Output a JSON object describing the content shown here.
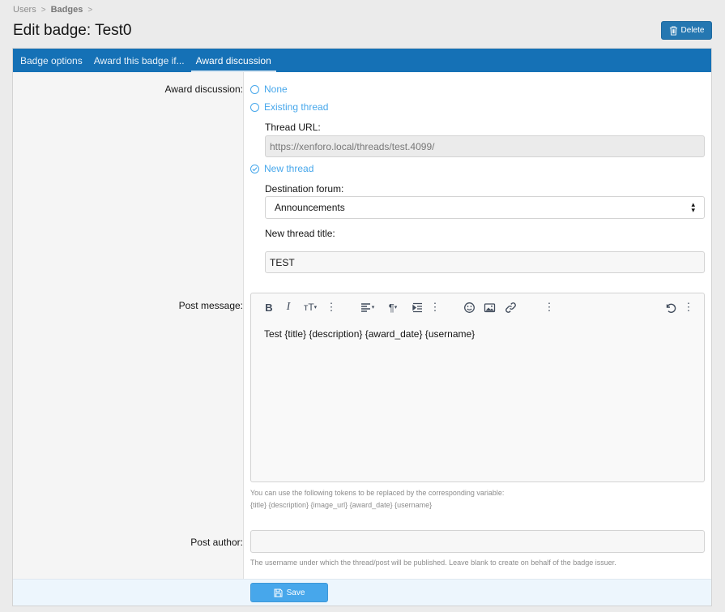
{
  "breadcrumb": {
    "items": [
      "Users",
      "Badges"
    ],
    "sep": ">"
  },
  "page_title": "Edit badge: Test0",
  "delete_label": "Delete",
  "tabs": [
    {
      "label": "Badge options"
    },
    {
      "label": "Award this badge if..."
    },
    {
      "label": "Award discussion"
    }
  ],
  "active_tab": "Award discussion",
  "form": {
    "award_discussion_label": "Award discussion:",
    "options": {
      "none": "None",
      "existing": "Existing thread",
      "new": "New thread"
    },
    "selected_option": "New thread",
    "thread_url_label": "Thread URL:",
    "thread_url_value": "https://xenforo.local/threads/test.4099/",
    "destination_forum_label": "Destination forum:",
    "destination_forum_value": "Announcements",
    "new_thread_title_label": "New thread title:",
    "new_thread_title_value": "TEST",
    "post_message_label": "Post message:",
    "post_message_value": "Test {title} {description} {award_date} {username}",
    "tokens_hint_line1": "You can use the following tokens to be replaced by the corresponding variable:",
    "tokens_hint_line2": "{title} {description} {image_url} {award_date} {username}",
    "post_author_label": "Post author:",
    "post_author_value": "",
    "post_author_hint": "The username under which the thread/post will be published. Leave blank to create on behalf of the badge issuer."
  },
  "save_label": "Save",
  "colors": {
    "accent": "#1571b6",
    "link": "#47a7eb",
    "button": "#2577b1"
  }
}
